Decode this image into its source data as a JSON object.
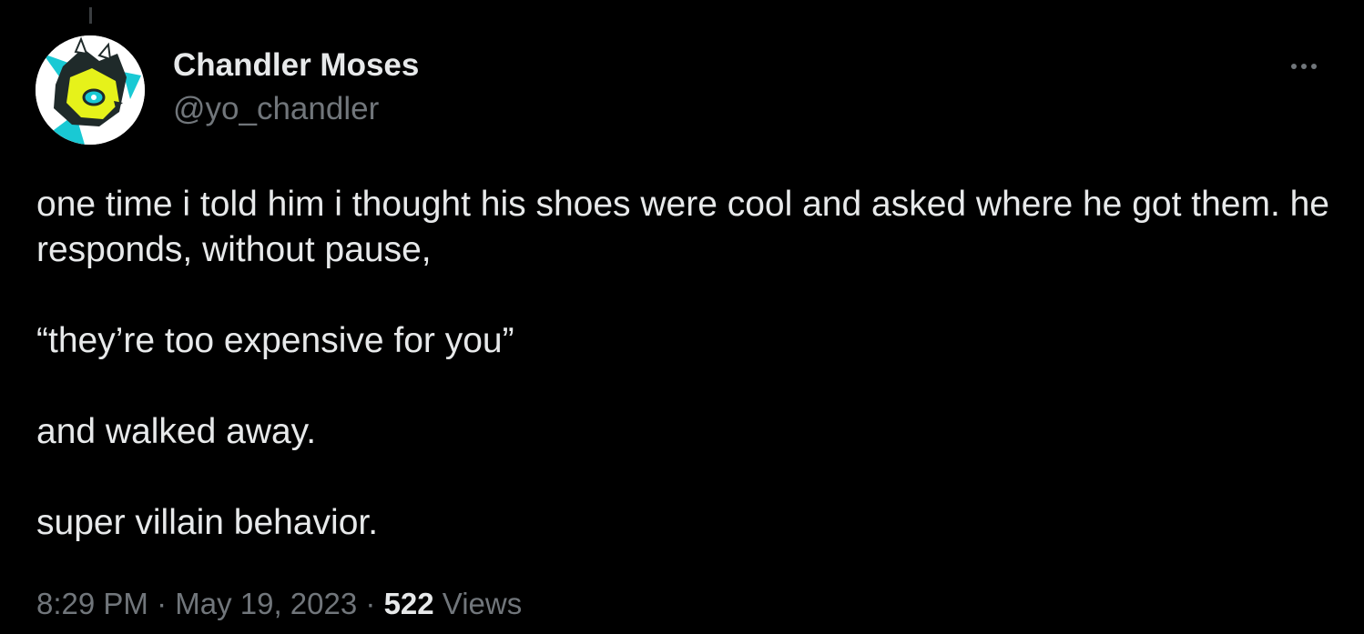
{
  "tweet": {
    "author": {
      "display_name": "Chandler Moses",
      "handle": "@yo_chandler",
      "avatar_icon": "fox-character-avatar"
    },
    "more_icon": "more-horizontal-icon",
    "paragraphs": [
      "one time i told him i thought his shoes were cool and asked where he got them. he responds, without pause,",
      "“they’re too expensive for you”",
      "and walked away.",
      "super villain behavior."
    ],
    "time": "8:29 PM",
    "separator": "·",
    "date": "May 19, 2023",
    "views_count": "522",
    "views_label": "Views"
  },
  "colors": {
    "background": "#000000",
    "primary_text": "#e7e9ea",
    "secondary_text": "#71767b",
    "avatar_accent_yellow": "#e6f21a",
    "avatar_accent_cyan": "#19c9d4"
  }
}
